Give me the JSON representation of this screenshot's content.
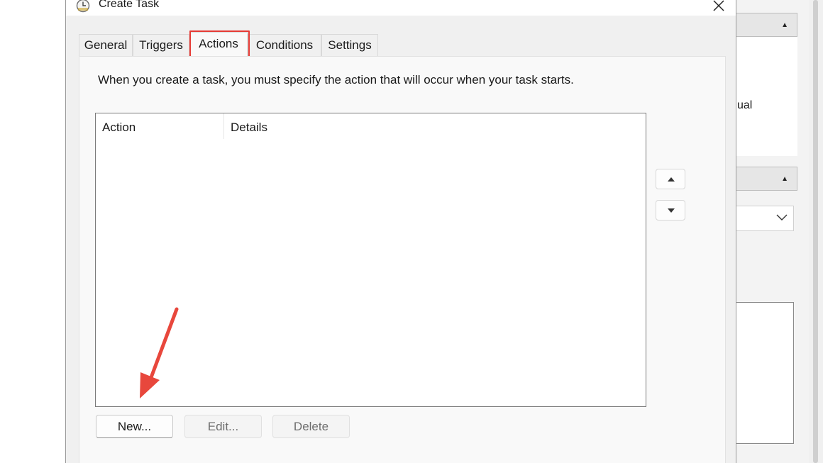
{
  "dialog": {
    "title": "Create Task",
    "tabs": [
      {
        "label": "General"
      },
      {
        "label": "Triggers"
      },
      {
        "label": "Actions"
      },
      {
        "label": "Conditions"
      },
      {
        "label": "Settings"
      }
    ],
    "active_tab": "Actions",
    "instructions": "When you create a task, you must specify the action that will occur when your task starts.",
    "list": {
      "columns": [
        "Action",
        "Details"
      ],
      "rows": []
    },
    "buttons": {
      "new": "New...",
      "edit": "Edit...",
      "delete": "Delete"
    }
  },
  "background": {
    "partial_text": "ual"
  },
  "colors": {
    "highlight": "#e63a35",
    "dialog_bg": "#f0f0f0",
    "panel_bg": "#f9f9f9"
  },
  "icons": {
    "title": "task-scheduler-clock-icon",
    "close": "close-icon",
    "move_up": "caret-up-icon",
    "move_down": "caret-down-icon",
    "annotation": "red-arrow-icon"
  }
}
